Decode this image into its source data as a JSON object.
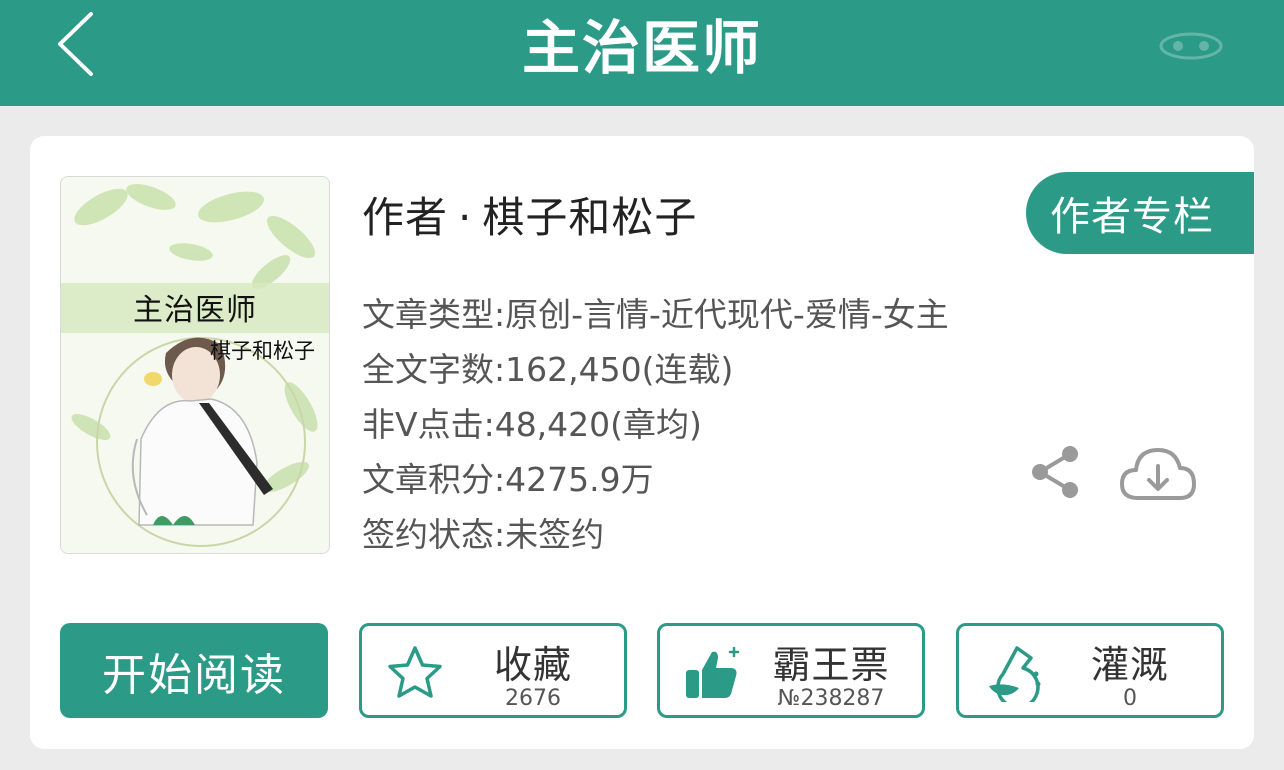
{
  "header": {
    "title": "主治医师",
    "back_icon": "chevron-left-icon"
  },
  "book": {
    "cover": {
      "title": "主治医师",
      "author": "棋子和松子"
    },
    "author_prefix": "作者",
    "author_separator": "·",
    "author": "棋子和松子",
    "author_column_button": "作者专栏",
    "meta": [
      "文章类型:原创-言情-近代现代-爱情-女主",
      "全文字数:162,450(连载)",
      "非V点击:48,420(章均)",
      "文章积分:4275.9万",
      "签约状态:未签约"
    ]
  },
  "actions": {
    "read_button": "开始阅读",
    "collect": {
      "label": "收藏",
      "count": "2676",
      "icon": "star-icon"
    },
    "vote": {
      "label": "霸王票",
      "count": "№238287",
      "icon": "thumbs-up-icon"
    },
    "water": {
      "label": "灌溉",
      "count": "0",
      "icon": "flask-icon"
    }
  },
  "colors": {
    "accent": "#2b9a86",
    "background": "#ebebeb",
    "card": "#ffffff"
  }
}
